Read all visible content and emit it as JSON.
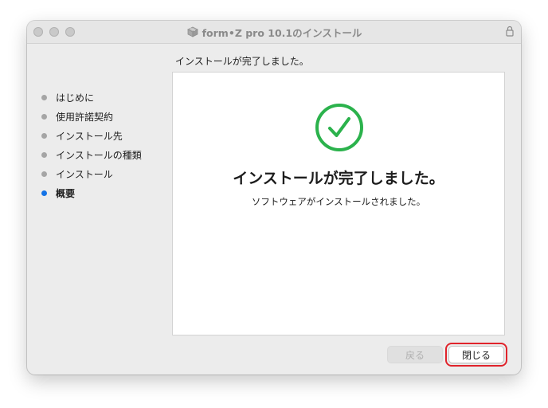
{
  "window": {
    "title": "form•Z pro 10.1のインストール",
    "title_icon": "package-icon",
    "lock_icon": "lock-icon"
  },
  "heading": "インストールが完了しました。",
  "sidebar": {
    "items": [
      {
        "label": "はじめに",
        "active": false
      },
      {
        "label": "使用許諾契約",
        "active": false
      },
      {
        "label": "インストール先",
        "active": false
      },
      {
        "label": "インストールの種類",
        "active": false
      },
      {
        "label": "インストール",
        "active": false
      },
      {
        "label": "概要",
        "active": true
      }
    ]
  },
  "content": {
    "icon": "checkmark-circle-icon",
    "title": "インストールが完了しました。",
    "message": "ソフトウェアがインストールされました。"
  },
  "buttons": {
    "back_label": "戻る",
    "back_enabled": false,
    "close_label": "閉じる"
  },
  "colors": {
    "success": "#2bb24c",
    "active_step": "#1473e6",
    "inactive_step": "#a5a5a5",
    "highlight": "#e0232b"
  }
}
